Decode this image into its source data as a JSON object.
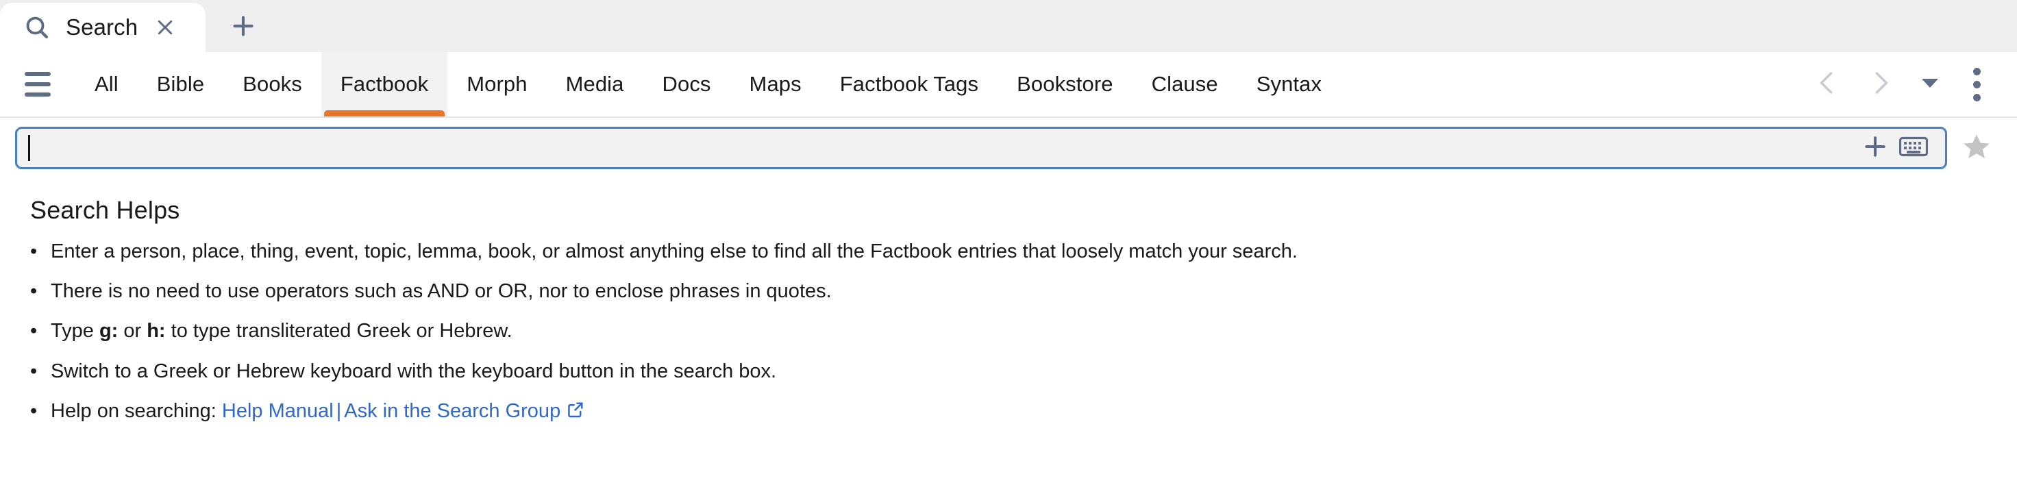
{
  "browser": {
    "tab": {
      "title": "Search",
      "icon": "search-icon",
      "close_icon": "close-icon"
    },
    "new_tab_label": "+"
  },
  "nav": {
    "menu_icon": "hamburger-menu-icon",
    "tabs": [
      {
        "label": "All",
        "active": false
      },
      {
        "label": "Bible",
        "active": false
      },
      {
        "label": "Books",
        "active": false
      },
      {
        "label": "Factbook",
        "active": true
      },
      {
        "label": "Morph",
        "active": false
      },
      {
        "label": "Media",
        "active": false
      },
      {
        "label": "Docs",
        "active": false
      },
      {
        "label": "Maps",
        "active": false
      },
      {
        "label": "Factbook Tags",
        "active": false
      },
      {
        "label": "Bookstore",
        "active": false
      },
      {
        "label": "Clause",
        "active": false
      },
      {
        "label": "Syntax",
        "active": false
      }
    ],
    "controls": {
      "back_icon": "chevron-left-icon",
      "forward_icon": "chevron-right-icon",
      "history_icon": "caret-down-icon",
      "overflow_icon": "kebab-menu-icon"
    }
  },
  "search": {
    "value": "",
    "placeholder": "",
    "add_icon": "plus-icon",
    "keyboard_icon": "keyboard-icon",
    "favorite_icon": "star-icon"
  },
  "helps": {
    "heading": "Search Helps",
    "items": [
      {
        "bullet": "•",
        "parts": [
          {
            "t": "Enter a person, place, thing, event, topic, lemma, book, or almost anything else to find all the Factbook entries that loosely match your search.",
            "k": "plain"
          }
        ]
      },
      {
        "bullet": "•",
        "parts": [
          {
            "t": "There is no need to use operators such as AND or OR, nor to enclose phrases in quotes.",
            "k": "plain"
          }
        ]
      },
      {
        "bullet": "•",
        "parts": [
          {
            "t": "Type ",
            "k": "plain"
          },
          {
            "t": "g:",
            "k": "bold"
          },
          {
            "t": " or ",
            "k": "plain"
          },
          {
            "t": "h:",
            "k": "bold"
          },
          {
            "t": " to type transliterated Greek or Hebrew.",
            "k": "plain"
          }
        ]
      },
      {
        "bullet": "•",
        "parts": [
          {
            "t": "Switch to a Greek or Hebrew keyboard with the keyboard button in the search box.",
            "k": "plain"
          }
        ]
      },
      {
        "bullet": "•",
        "parts": [
          {
            "t": "Help on searching: ",
            "k": "plain"
          },
          {
            "t": "Help Manual",
            "k": "link"
          },
          {
            "t": "|",
            "k": "sep"
          },
          {
            "t": "Ask in the Search Group",
            "k": "link"
          },
          {
            "t": "external-link-icon",
            "k": "exticon"
          }
        ]
      }
    ]
  },
  "colors": {
    "accent_orange": "#e8752a",
    "link_blue": "#2f68c8",
    "focus_blue": "#4a7fc1",
    "icon_slate": "#5f6c85",
    "chrome_gray": "#efefef",
    "active_tab_gray": "#f2f2f2",
    "star_gray": "#c4c4c4"
  }
}
